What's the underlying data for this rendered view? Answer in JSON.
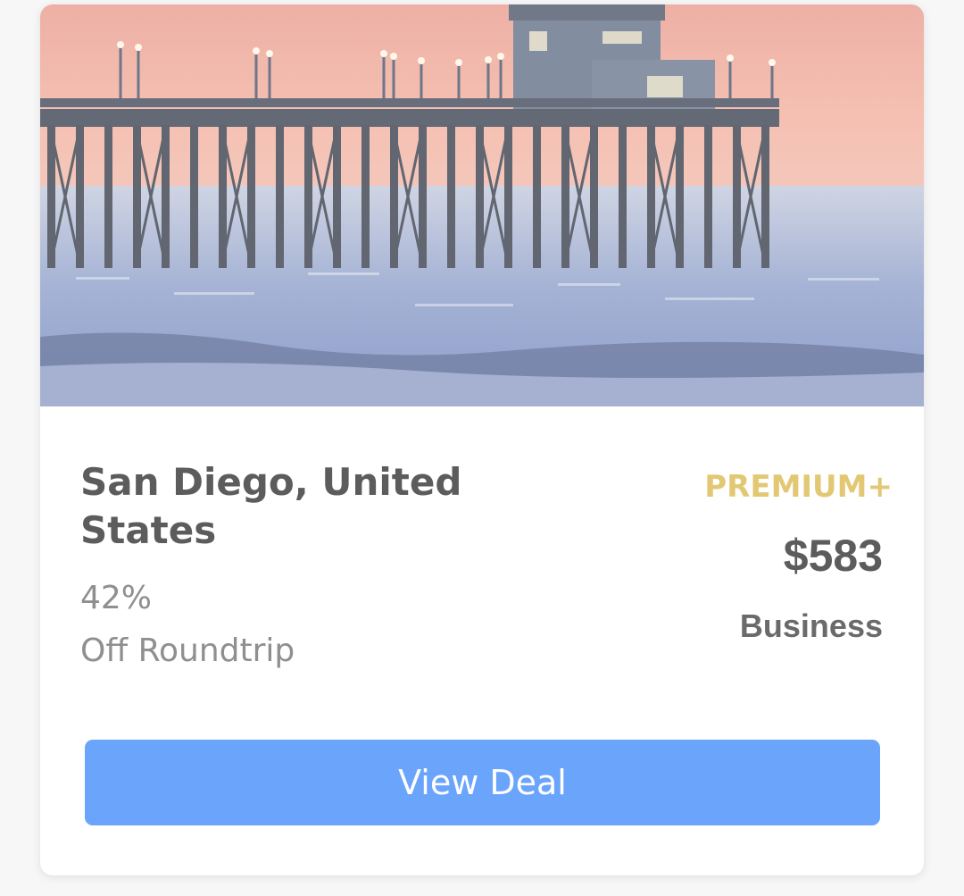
{
  "deal": {
    "destination": "San Diego, United States",
    "discount_percent": "42%",
    "discount_label": "Off Roundtrip",
    "tier": "PREMIUM+",
    "price": "$583",
    "cabin_class": "Business",
    "cta_label": "View Deal"
  },
  "colors": {
    "tier": "#e3c874",
    "cta_background": "#6aa4fb",
    "title": "#5c5c5c",
    "muted": "#8f8f8f"
  }
}
